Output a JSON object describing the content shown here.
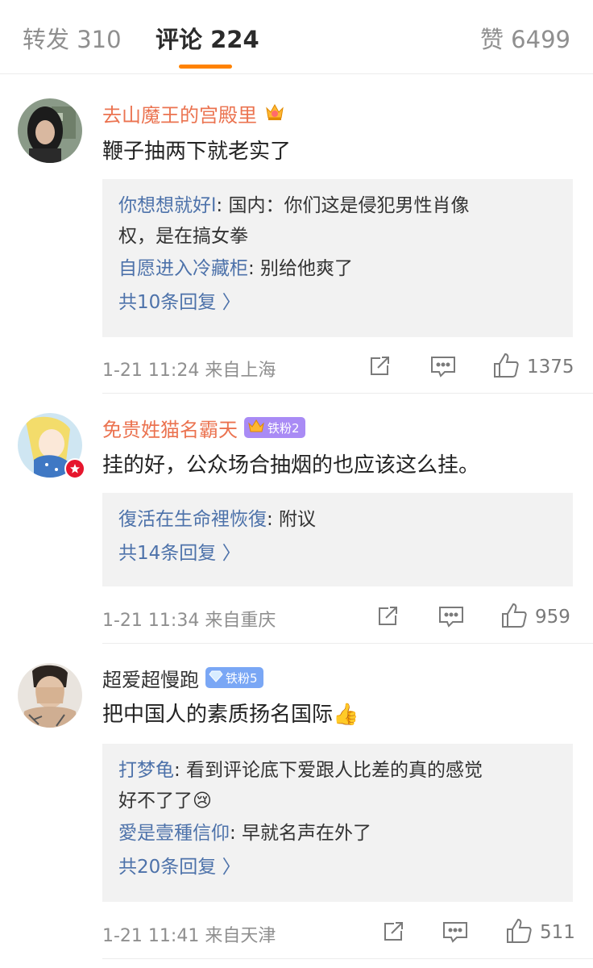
{
  "tabs": {
    "repost": "转发 310",
    "comments": "评论 224",
    "likes": "赞 6499"
  },
  "comments": [
    {
      "username": "去山魔王的宫殿里",
      "text": "鞭子抽两下就老实了",
      "replies": [
        {
          "name": "你想想就好l",
          "text": ": 国内：你们这是侵犯男性肖像",
          "text2": "权，是在搞女拳"
        },
        {
          "name": "自愿进入冷藏柜",
          "text": ": 别给他爽了"
        }
      ],
      "more": "共10条回复 〉",
      "time": "1-21 11:24 来自上海",
      "likes": "1375"
    },
    {
      "username": "免贵姓猫名霸天",
      "fan_tag": "铁粉2",
      "text": "挂的好，公众场合抽烟的也应该这么挂。",
      "replies": [
        {
          "name": "復活在生命裡恢復",
          "text": ": 附议"
        }
      ],
      "more": "共14条回复 〉",
      "time": "1-21 11:34 来自重庆",
      "likes": "959"
    },
    {
      "username": "超爱超慢跑",
      "fan_tag": "铁粉5",
      "text": "把中国人的素质扬名国际👍",
      "replies": [
        {
          "name": "打梦龟",
          "text": ": 看到评论底下爱跟人比差的真的感觉",
          "text2": "好不了了😢"
        },
        {
          "name": "愛是壹種信仰",
          "text": ": 早就名声在外了"
        }
      ],
      "more": "共20条回复 〉",
      "time": "1-21 11:41 来自天津",
      "likes": "511"
    }
  ],
  "colors": {
    "accent": "#ff8200",
    "username_orange": "#eb7350",
    "reply_link": "#4d72aa"
  }
}
